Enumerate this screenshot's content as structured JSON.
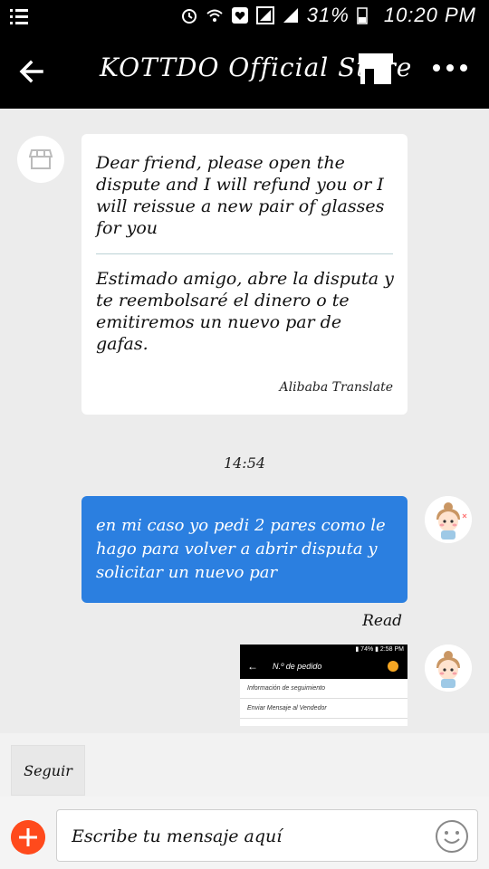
{
  "status_bar": {
    "battery": "31%",
    "time": "10:20 PM"
  },
  "app_bar": {
    "title": "KOTTDO Official Store"
  },
  "chat": {
    "incoming_message": {
      "text_en": "Dear friend, please open the dispute and I will refund you or I will reissue a new pair of glasses for you",
      "text_es": "Estimado amigo, abre la disputa y te reembolsaré el dinero o te emitiremos un nuevo par de gafas.",
      "translation_credit": "Alibaba Translate"
    },
    "timestamp": "14:54",
    "outgoing_message": {
      "text": "en mi caso yo pedi 2 pares como le hago para volver a abrir disputa y solicitar un nuevo par",
      "status": "Read"
    },
    "screenshot_attachment": {
      "status_text": "▮ 74% ▮ 2:58 PM",
      "header": "N.º de pedido",
      "row1": "Información de seguimiento",
      "row2": "Enviar Mensaje al Vendedor"
    }
  },
  "follow_button": {
    "label": "Seguir"
  },
  "composer": {
    "placeholder": "Escribe tu mensaje aquí"
  },
  "colors": {
    "bar_bg": "#000000",
    "chat_bg": "#ececec",
    "outgoing_bubble": "#2b7fe0",
    "add_button": "#ff4a1c"
  },
  "icons": [
    "menu-icon",
    "alarm-icon",
    "wifi-icon",
    "heart-icon",
    "signal-icon",
    "battery-icon",
    "back-arrow-icon",
    "store-icon",
    "more-icon",
    "store-avatar-icon",
    "user-avatar",
    "plus-icon",
    "emoji-icon"
  ]
}
